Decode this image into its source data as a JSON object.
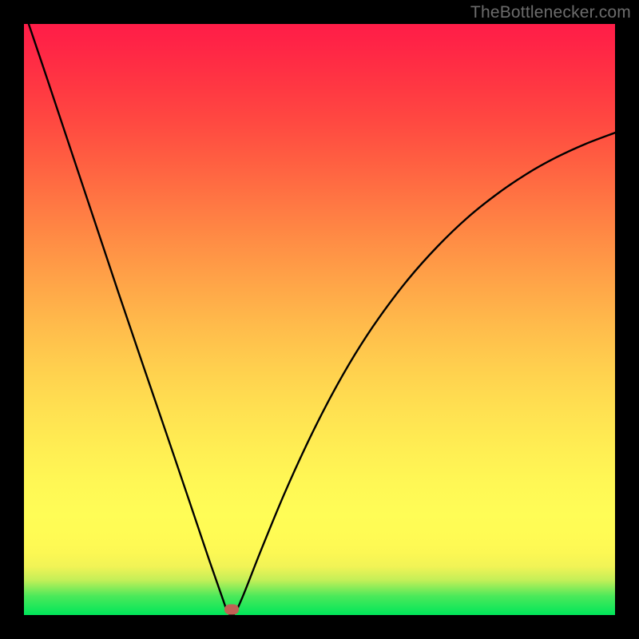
{
  "attribution": "TheBottlenecker.com",
  "colors": {
    "frame": "#000000",
    "attribution_text": "#6c6c6c",
    "curve_stroke": "#000000",
    "marker_fill": "#c16155",
    "gradient_top": "#ff1d48",
    "gradient_bottom": "#00e65a"
  },
  "chart_data": {
    "type": "line",
    "title": "",
    "xlabel": "",
    "ylabel": "",
    "xlim": [
      0,
      100
    ],
    "ylim": [
      0,
      100
    ],
    "series": [
      {
        "name": "bottleneck-curve",
        "x": [
          0.8,
          4,
          8,
          12,
          16,
          20,
          24,
          28,
          31,
          33.5,
          34.5,
          35.5,
          37,
          40,
          44,
          48,
          52,
          56,
          60,
          65,
          70,
          75,
          80,
          85,
          90,
          95,
          100
        ],
        "y": [
          100,
          90.5,
          78.5,
          66.5,
          54.5,
          42.7,
          31,
          19.2,
          10.3,
          3.1,
          0.5,
          0.1,
          3.1,
          10.7,
          20.4,
          29.2,
          37.1,
          44.1,
          50.2,
          56.8,
          62.4,
          67.2,
          71.2,
          74.6,
          77.4,
          79.7,
          81.6
        ]
      }
    ],
    "annotations": [
      {
        "name": "low-point-marker",
        "x": 35.1,
        "y": 0.9
      }
    ],
    "background_gradient": {
      "direction": "vertical",
      "stops": [
        {
          "y": 0,
          "color": "#00e65a"
        },
        {
          "y": 15,
          "color": "#fffd56"
        },
        {
          "y": 50,
          "color": "#ffbb4b"
        },
        {
          "y": 100,
          "color": "#ff1d48"
        }
      ]
    }
  }
}
